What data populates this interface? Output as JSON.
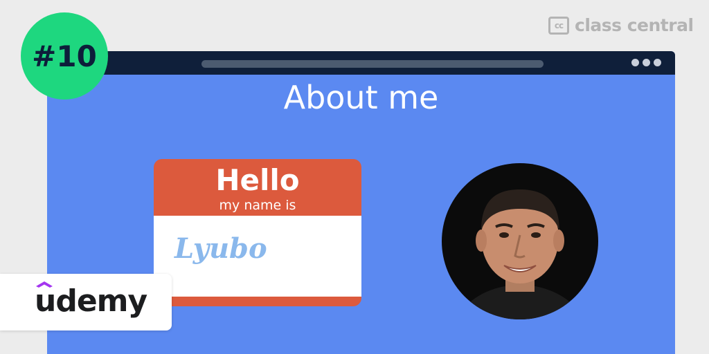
{
  "brand": {
    "name": "class central",
    "mark": "cc",
    "color": "#b4b4b4"
  },
  "badge": {
    "rank": "#10",
    "color": "#1ed77f"
  },
  "window": {
    "menu_icon": "more-dots-icon",
    "page_title": "About me",
    "background": "#5b89f1"
  },
  "name_tag": {
    "greeting": "Hello",
    "subtitle": "my name is",
    "name": "Lyubo",
    "accent": "#dc5a3d"
  },
  "avatar": {
    "icon": "instructor-photo"
  },
  "provider": {
    "name": "udemy",
    "accent": "#a435f0"
  }
}
